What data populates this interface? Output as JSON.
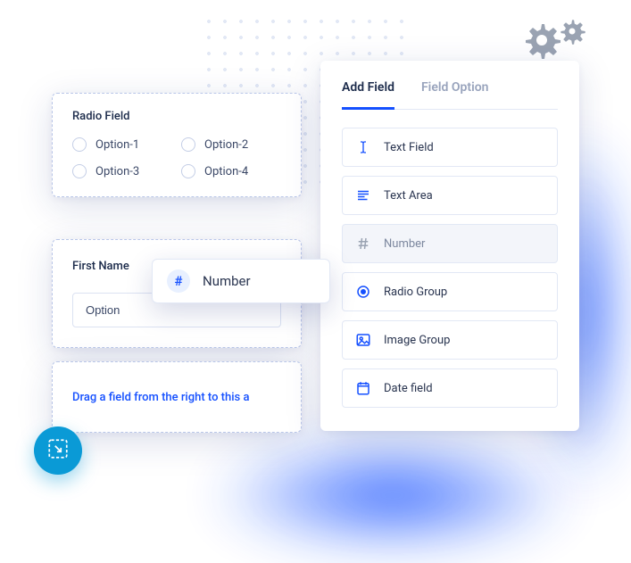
{
  "radio_card": {
    "title": "Radio Field",
    "options": [
      "Option-1",
      "Option-2",
      "Option-3",
      "Option-4"
    ]
  },
  "first_name_card": {
    "title": "First Name",
    "input_value": "Option"
  },
  "dropzone": {
    "text": "Drag a field from the right to this a"
  },
  "drag_chip": {
    "icon": "hash-icon",
    "label": "Number"
  },
  "panel": {
    "tabs": {
      "add_field": "Add Field",
      "field_option": "Field Option"
    },
    "fields": [
      {
        "icon": "text-cursor-icon",
        "label": "Text Field",
        "selected": false
      },
      {
        "icon": "text-lines-icon",
        "label": "Text Area",
        "selected": false
      },
      {
        "icon": "hash-icon",
        "label": "Number",
        "selected": true
      },
      {
        "icon": "radio-icon",
        "label": "Radio Group",
        "selected": false
      },
      {
        "icon": "image-icon",
        "label": "Image Group",
        "selected": false
      },
      {
        "icon": "calendar-icon",
        "label": "Date field",
        "selected": false
      }
    ]
  },
  "colors": {
    "primary": "#1550ff",
    "accent_fab": "#0a9ad6",
    "muted": "#98a3bc"
  }
}
